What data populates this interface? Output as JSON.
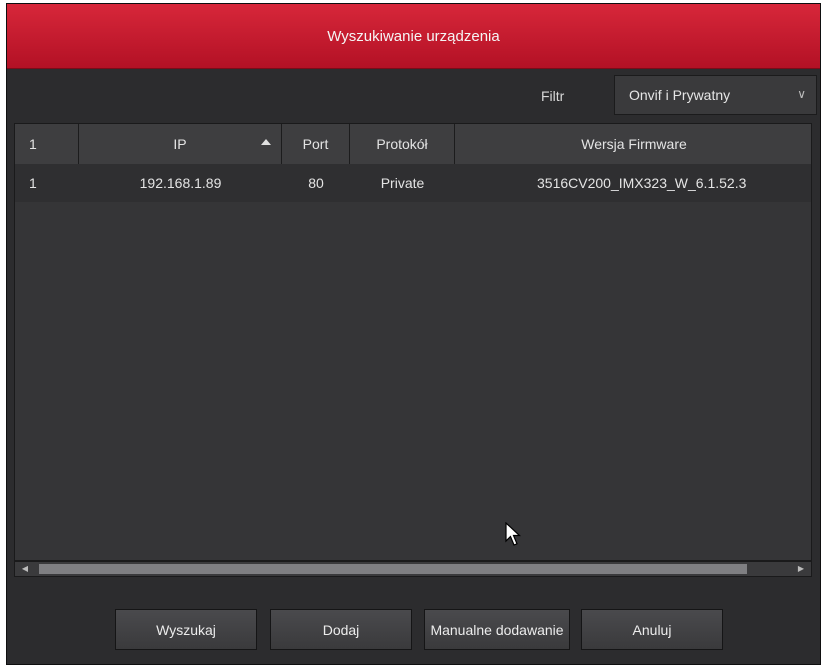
{
  "dialog": {
    "title": "Wyszukiwanie urządzenia"
  },
  "filter": {
    "label": "Filtr",
    "selected": "Onvif i Prywatny",
    "chevron_icon": "chevron-down-icon"
  },
  "table": {
    "columns": [
      "1",
      "IP",
      "Port",
      "Protokół",
      "Wersja Firmware"
    ],
    "sort_icon": "sort-ascending-icon",
    "rows": [
      {
        "num": "1",
        "ip": "192.168.1.89",
        "port": "80",
        "protocol": "Private",
        "firmware": "3516CV200_IMX323_W_6.1.52.3"
      }
    ]
  },
  "buttons": {
    "search": "Wyszukaj",
    "add": "Dodaj",
    "manual_add": "Manualne dodawanie",
    "cancel": "Anuluj"
  },
  "colors": {
    "title_bar": "#c41a2e",
    "background": "#2c2c2e"
  }
}
